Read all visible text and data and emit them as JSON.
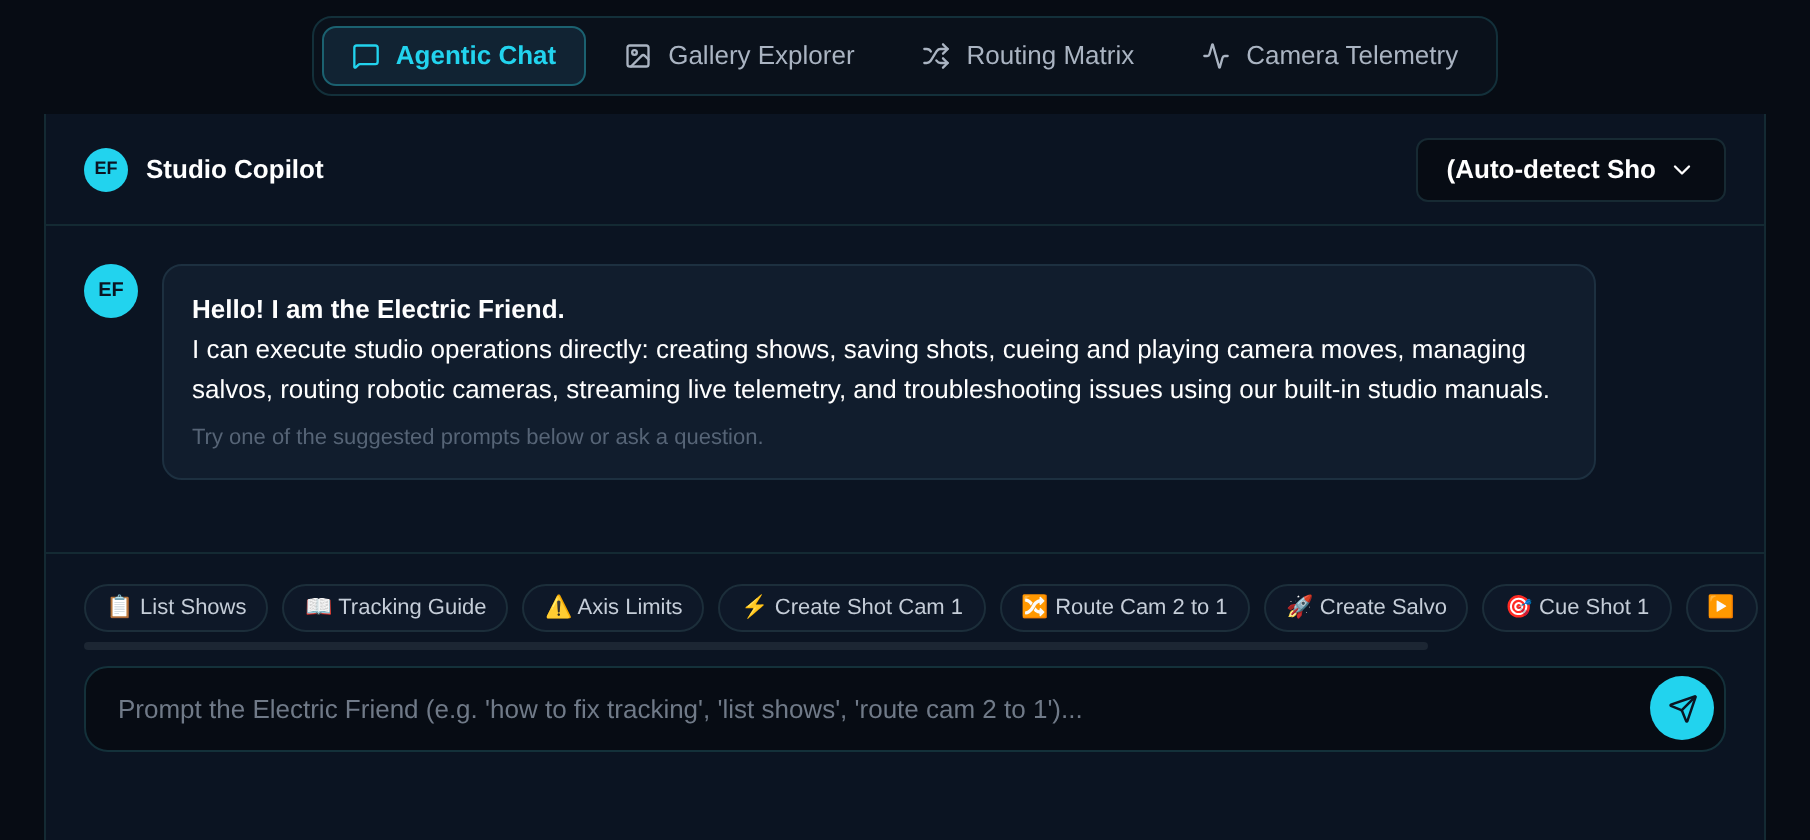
{
  "tabs": [
    {
      "label": "Agentic Chat",
      "kind": "chat",
      "selected": true
    },
    {
      "label": "Gallery Explorer",
      "kind": "image",
      "selected": false
    },
    {
      "label": "Routing Matrix",
      "kind": "shuffle",
      "selected": false
    },
    {
      "label": "Camera Telemetry",
      "kind": "pulse",
      "selected": false
    }
  ],
  "header": {
    "avatar": "EF",
    "title": "Studio Copilot",
    "select_value": "(Auto-detect Sho"
  },
  "message": {
    "avatar": "EF",
    "heading": "Hello! I am the Electric Friend.",
    "body": "I can execute studio operations directly: creating shows, saving shots, cueing and playing camera moves, managing salvos, routing robotic cameras, streaming live telemetry, and troubleshooting issues using our built-in studio manuals.",
    "hint": "Try one of the suggested prompts below or ask a question."
  },
  "suggestions": [
    "📋 List Shows",
    "📖 Tracking Guide",
    "⚠️ Axis Limits",
    "⚡ Create Shot Cam 1",
    "🔀 Route Cam 2 to 1",
    "🚀 Create Salvo",
    "🎯 Cue Shot 1",
    "▶️"
  ],
  "input": {
    "placeholder": "Prompt the Electric Friend (e.g. 'how to fix tracking', 'list shows', 'route cam 2 to 1')..."
  }
}
